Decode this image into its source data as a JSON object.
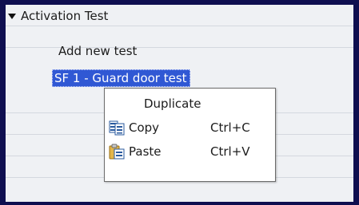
{
  "tree": {
    "parent": {
      "label": "Activation Test",
      "icon": "triangle-down-icon",
      "expanded": true
    },
    "add_new": {
      "label": "Add new test"
    },
    "selected_item": {
      "label": "SF 1 - Guard door test"
    }
  },
  "context_menu": {
    "items": [
      {
        "label": "Duplicate",
        "shortcut": "",
        "icon": ""
      },
      {
        "label": "Copy",
        "shortcut": "Ctrl+C",
        "icon": "copy-icon"
      },
      {
        "label": "Paste",
        "shortcut": "Ctrl+V",
        "icon": "paste-icon"
      }
    ]
  },
  "colors": {
    "frame": "#0f0f50",
    "panel": "#eff1f4",
    "selection": "#3058d4",
    "row_divider": "#d4d8df"
  }
}
